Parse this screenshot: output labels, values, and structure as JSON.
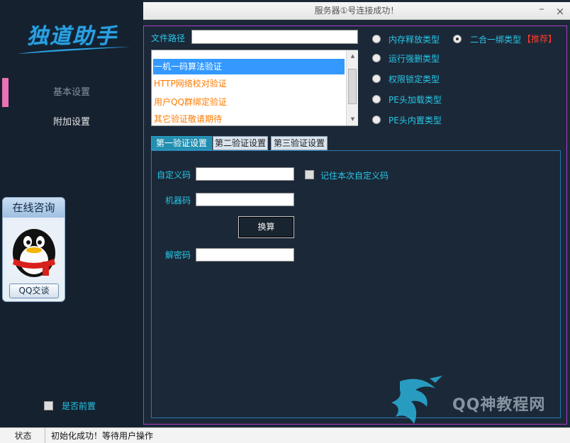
{
  "sidebar": {
    "logo": "独道助手",
    "nav": [
      {
        "label": "基本设置"
      },
      {
        "label": "附加设置"
      }
    ],
    "consult": {
      "title": "在线咨询",
      "qq_button": "QQ交谈"
    },
    "topmost_label": "是否前置"
  },
  "titlebar": {
    "title": "服务器①号连接成功！",
    "minimize": "–",
    "close": "×"
  },
  "form": {
    "filepath_label": "文件路径",
    "filepath_value": "",
    "list_items": [
      "一机一码算法验证",
      "HTTP网络校对验证",
      "用户QQ群绑定验证",
      "其它验证敬请期待"
    ],
    "radios": [
      {
        "label": "内存释放类型",
        "checked": false
      },
      {
        "label": "运行强删类型",
        "checked": false
      },
      {
        "label": "权限锁定类型",
        "checked": false
      },
      {
        "label": "PE头加载类型",
        "checked": false
      },
      {
        "label": "PE头内置类型",
        "checked": false
      },
      {
        "label": "二合一绑类型",
        "checked": true
      }
    ],
    "recommend": "【推荐】"
  },
  "tabs": [
    {
      "label": "第一验证设置"
    },
    {
      "label": "第二验证设置"
    },
    {
      "label": "第三验证设置"
    }
  ],
  "tab_panel": {
    "custom_code_label": "自定义码",
    "custom_code_value": "",
    "remember_label": "记住本次自定义码",
    "machine_code_label": "机器码",
    "machine_code_value": "",
    "compute_button": "换算",
    "decode_label": "解密码",
    "decode_value": ""
  },
  "watermark": "QQ神教程网",
  "statusbar": {
    "label": "状态",
    "message": "初始化成功！等待用户操作"
  },
  "colors": {
    "background": "#1b2838",
    "accent_cyan": "#27c8e8",
    "frame_magenta": "#b239c6",
    "list_orange": "#ff7a00",
    "selected_blue": "#3399ff",
    "recommend_red": "#ff3a2a"
  }
}
